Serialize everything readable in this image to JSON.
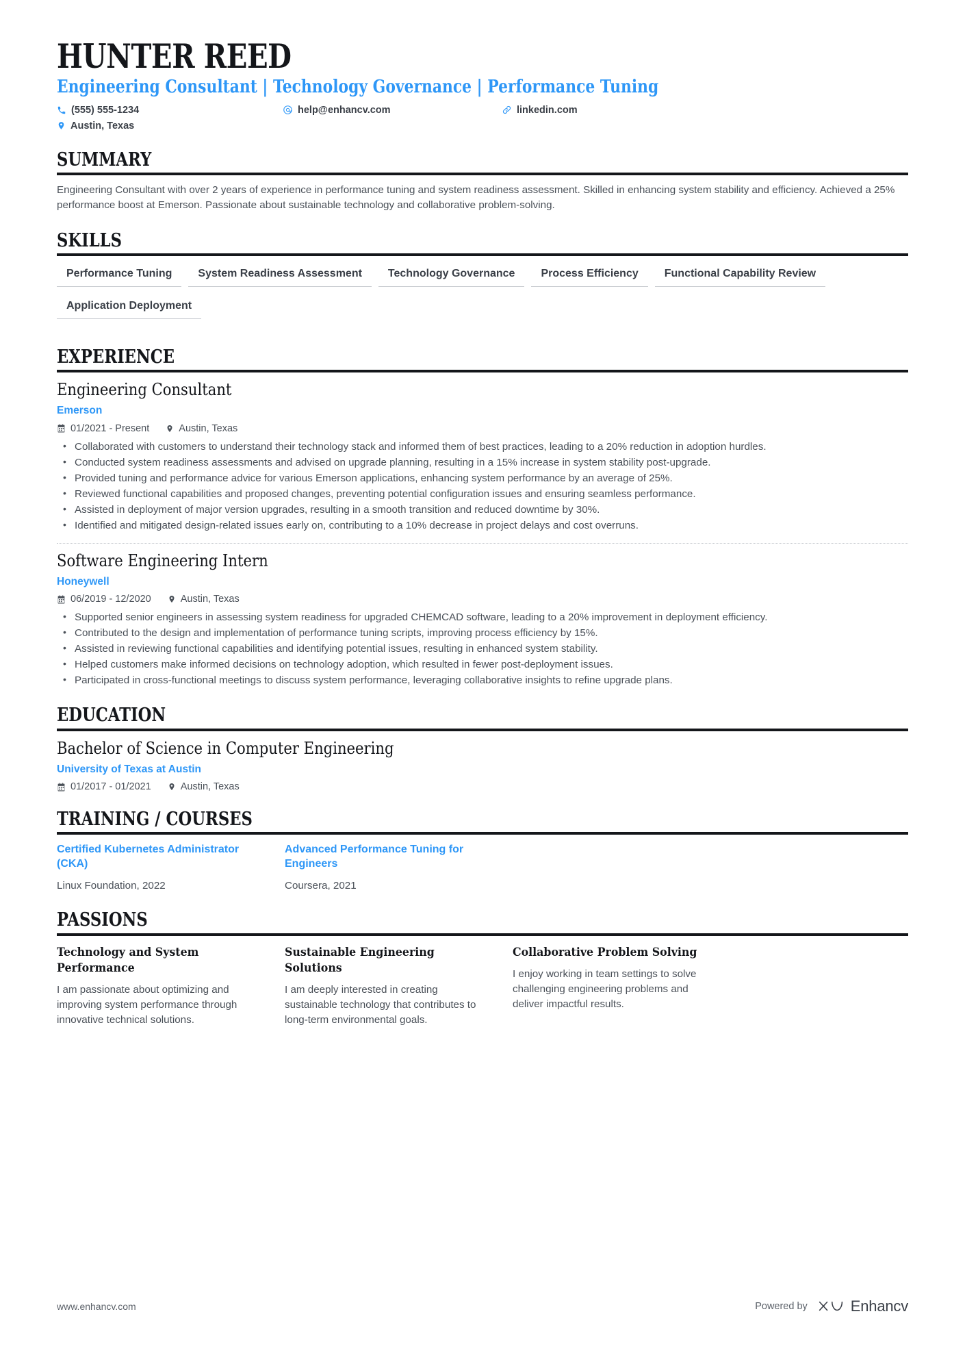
{
  "header": {
    "name": "HUNTER REED",
    "headline": "Engineering Consultant | Technology Governance | Performance Tuning",
    "contacts": [
      {
        "icon": "phone-icon",
        "text": "(555) 555-1234"
      },
      {
        "icon": "email-icon",
        "text": "help@enhancv.com"
      },
      {
        "icon": "link-icon",
        "text": "linkedin.com"
      },
      {
        "icon": "location-pin-icon",
        "text": "Austin, Texas"
      }
    ]
  },
  "summary": {
    "heading": "SUMMARY",
    "text": "Engineering Consultant with over 2 years of experience in performance tuning and system readiness assessment. Skilled in enhancing system stability and efficiency. Achieved a 25% performance boost at Emerson. Passionate about sustainable technology and collaborative problem-solving."
  },
  "skills": {
    "heading": "SKILLS",
    "items": [
      "Performance Tuning",
      "System Readiness Assessment",
      "Technology Governance",
      "Process Efficiency",
      "Functional Capability Review",
      "Application Deployment"
    ]
  },
  "experience": {
    "heading": "EXPERIENCE",
    "entries": [
      {
        "title": "Engineering Consultant",
        "company": "Emerson",
        "dates": "01/2021 - Present",
        "location": "Austin, Texas",
        "bullets": [
          "Collaborated with customers to understand their technology stack and informed them of best practices, leading to a 20% reduction in adoption hurdles.",
          "Conducted system readiness assessments and advised on upgrade planning, resulting in a 15% increase in system stability post-upgrade.",
          "Provided tuning and performance advice for various Emerson applications, enhancing system performance by an average of 25%.",
          "Reviewed functional capabilities and proposed changes, preventing potential configuration issues and ensuring seamless performance.",
          "Assisted in deployment of major version upgrades, resulting in a smooth transition and reduced downtime by 30%.",
          "Identified and mitigated design-related issues early on, contributing to a 10% decrease in project delays and cost overruns."
        ]
      },
      {
        "title": "Software Engineering Intern",
        "company": "Honeywell",
        "dates": "06/2019 - 12/2020",
        "location": "Austin, Texas",
        "bullets": [
          "Supported senior engineers in assessing system readiness for upgraded CHEMCAD software, leading to a 20% improvement in deployment efficiency.",
          "Contributed to the design and implementation of performance tuning scripts, improving process efficiency by 15%.",
          "Assisted in reviewing functional capabilities and identifying potential issues, resulting in enhanced system stability.",
          "Helped customers make informed decisions on technology adoption, which resulted in fewer post-deployment issues.",
          "Participated in cross-functional meetings to discuss system performance, leveraging collaborative insights to refine upgrade plans."
        ]
      }
    ]
  },
  "education": {
    "heading": "EDUCATION",
    "entries": [
      {
        "degree": "Bachelor of Science in Computer Engineering",
        "school": "University of Texas at Austin",
        "dates": "01/2017 - 01/2021",
        "location": "Austin, Texas"
      }
    ]
  },
  "training": {
    "heading": "TRAINING / COURSES",
    "items": [
      {
        "title": "Certified Kubernetes Administrator (CKA)",
        "provider": "Linux Foundation, 2022"
      },
      {
        "title": "Advanced Performance Tuning for Engineers",
        "provider": "Coursera, 2021"
      }
    ]
  },
  "passions": {
    "heading": "PASSIONS",
    "items": [
      {
        "title": "Technology and System Performance",
        "text": "I am passionate about optimizing and improving system performance through innovative technical solutions."
      },
      {
        "title": "Sustainable Engineering Solutions",
        "text": "I am deeply interested in creating sustainable technology that contributes to long-term environmental goals."
      },
      {
        "title": "Collaborative Problem Solving",
        "text": "I enjoy working in team settings to solve challenging engineering problems and deliver impactful results."
      }
    ]
  },
  "footer": {
    "url": "www.enhancv.com",
    "powered_by": "Powered by",
    "brand": "Enhancv"
  },
  "colors": {
    "accent": "#2e97f7",
    "ink": "#14161a",
    "body": "#4a5058",
    "rule": "#c9ccd1"
  }
}
